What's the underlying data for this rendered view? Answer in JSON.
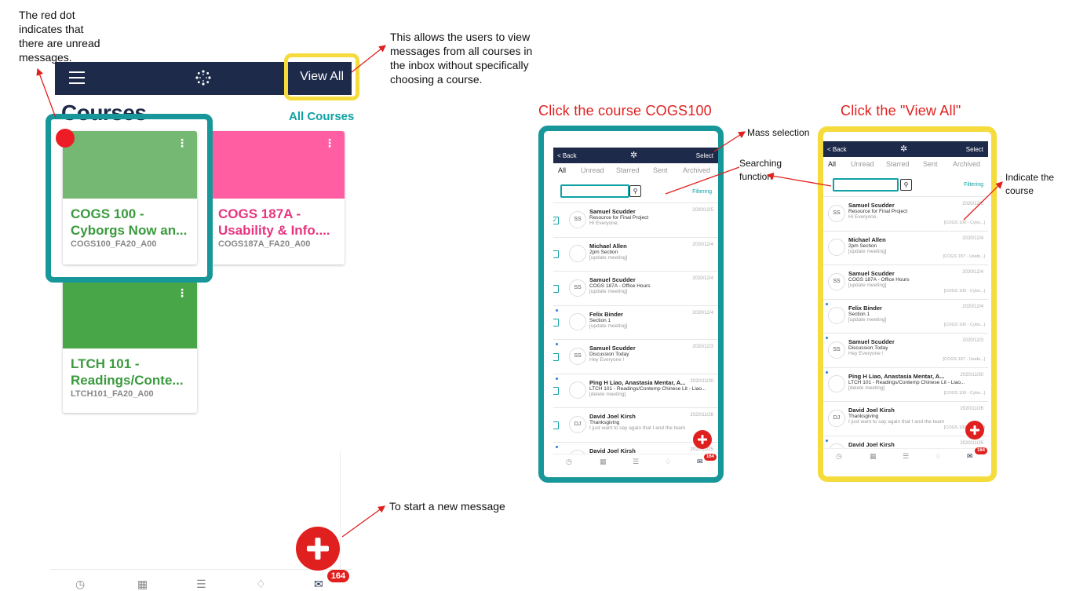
{
  "annotations": {
    "red_dot_note": [
      "The red dot",
      "indicates that",
      "there are unread",
      "messages."
    ],
    "view_all_note": [
      "This allows the users to view",
      "messages from all courses in",
      "the inbox without specifically",
      "choosing a course."
    ],
    "new_message_note": "To start a new message",
    "mass_selection": "Mass selection",
    "searching_note": [
      "Searching",
      "function"
    ],
    "indicate_course_note": [
      "Indicate the",
      "course"
    ],
    "heading_course": "Click the course COGS100",
    "heading_view_all": "Click the \"View All\""
  },
  "left_app": {
    "view_all": "View All",
    "courses_title": "Courses",
    "all_courses": "All Courses",
    "cards": [
      {
        "title_line1": "COGS 100 -",
        "title_line2": "Cyborgs Now an...",
        "code": "COGS100_FA20_A00",
        "color": "#75b873",
        "text_color": "#3a9a3e"
      },
      {
        "title_line1": "COGS 187A -",
        "title_line2": "Usability & Info....",
        "code": "COGS187A_FA20_A00",
        "color": "#ff5fa2",
        "text_color": "#e8347f"
      },
      {
        "title_line1": "LTCH 101 -",
        "title_line2": "Readings/Conte...",
        "code": "LTCH101_FA20_A00",
        "color": "#49a648",
        "text_color": "#3a9a3e"
      }
    ],
    "badge": "164",
    "accent_teal": "#10a1a4",
    "accent_yellow": "#f5dc3c",
    "accent_red": "#e0201e"
  },
  "phones": {
    "back": "< Back",
    "select": "Select",
    "tabs": [
      "All",
      "Unread",
      "Starred",
      "Sent",
      "Archived"
    ],
    "filtering": "Filtering",
    "badge": "164",
    "messages": [
      {
        "avatar": "SS",
        "name": "Samuel Scudder",
        "subject": "Resource for Final Project",
        "preview": "Hi Everyone,",
        "date": "2020/12/5",
        "course": "[COGS 100 - Cybo...]"
      },
      {
        "avatar": "",
        "name": "Michael Allen",
        "subject": "2pm Section",
        "preview": "[update meeting]",
        "date": "2020/12/4",
        "course": "[COGS 187 - Usabi...]"
      },
      {
        "avatar": "SS",
        "name": "Samuel Scudder",
        "subject": "COGS 187A - Office Hours",
        "preview": "[update meeting]",
        "date": "2020/12/4",
        "course": "[COGS 100 - Cybo...]"
      },
      {
        "avatar": "",
        "name": "Felix Binder",
        "subject": "Section 1",
        "preview": "[update meeting]",
        "date": "2020/12/4",
        "course": "[COGS 100 - Cybo...]"
      },
      {
        "avatar": "SS",
        "name": "Samuel Scudder",
        "subject": "Discussion Today",
        "preview": "Hey Everyone !",
        "date": "2020/12/3",
        "course": "[COGS 187 - Usabi...]"
      },
      {
        "avatar": "",
        "name": "Ping H Liao, Anastasia Mentar, A...",
        "subject": "LTCH 101 - Readings/Contemp Chinese Lit - Liao...",
        "preview": "[delete meeting]",
        "date": "2020/11/30",
        "course": "[COGS 100 - Cybo...]"
      },
      {
        "avatar": "DJ",
        "name": "David Joel Kirsh",
        "subject": "Thanksgiving",
        "preview": "I just want to say again that I and the team",
        "date": "2020/11/26",
        "course": "[COGS 100 - Cybo...]"
      },
      {
        "avatar": "",
        "name": "David Joel Kirsh",
        "subject": "",
        "preview": "",
        "date": "2020/11/25",
        "course": ""
      }
    ]
  }
}
